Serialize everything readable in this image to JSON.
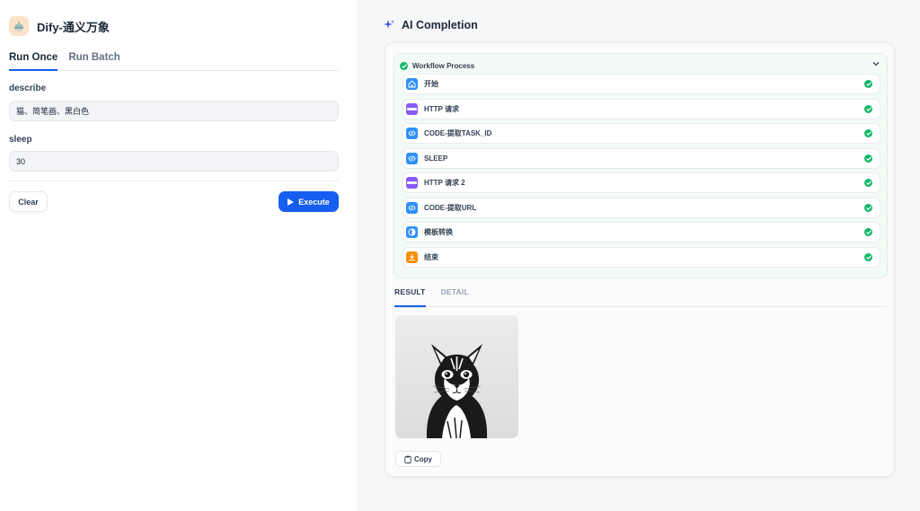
{
  "app": {
    "title": "Dify-通义万象",
    "icon": "teapot-icon"
  },
  "tabs": [
    {
      "label": "Run Once",
      "active": true
    },
    {
      "label": "Run Batch",
      "active": false
    }
  ],
  "form": {
    "describe": {
      "label": "describe",
      "value": "猫、简笔画、黑白色"
    },
    "sleep": {
      "label": "sleep",
      "value": "30"
    },
    "clear_label": "Clear",
    "execute_label": "Execute"
  },
  "result": {
    "title": "AI Completion",
    "title_icon": "sparkle-icon",
    "workflow": {
      "title": "Workflow Process",
      "status": "success",
      "nodes": [
        {
          "label": "开始",
          "icon": "home-icon",
          "color": "#2e90fa",
          "status": "success"
        },
        {
          "label": "HTTP 请求",
          "icon": "http-icon",
          "color": "#875bf7",
          "status": "success"
        },
        {
          "label": "CODE-提取TASK_ID",
          "icon": "code-icon",
          "color": "#2e90fa",
          "status": "success"
        },
        {
          "label": "SLEEP",
          "icon": "code-icon",
          "color": "#2e90fa",
          "status": "success"
        },
        {
          "label": "HTTP 请求 2",
          "icon": "http-icon",
          "color": "#875bf7",
          "status": "success"
        },
        {
          "label": "CODE-提取URL",
          "icon": "code-icon",
          "color": "#2e90fa",
          "status": "success"
        },
        {
          "label": "模板转换",
          "icon": "template-icon",
          "color": "#2e90fa",
          "status": "success"
        },
        {
          "label": "结束",
          "icon": "end-icon",
          "color": "#f79009",
          "status": "success"
        }
      ]
    },
    "tabs": [
      {
        "label": "RESULT",
        "active": true
      },
      {
        "label": "DETAIL",
        "active": false
      }
    ],
    "image_alt": "cat-sketch-image",
    "copy_label": "Copy"
  },
  "colors": {
    "primary": "#155eef",
    "success": "#12b76a",
    "code": "#2e90fa",
    "http": "#875bf7",
    "end": "#f79009"
  }
}
